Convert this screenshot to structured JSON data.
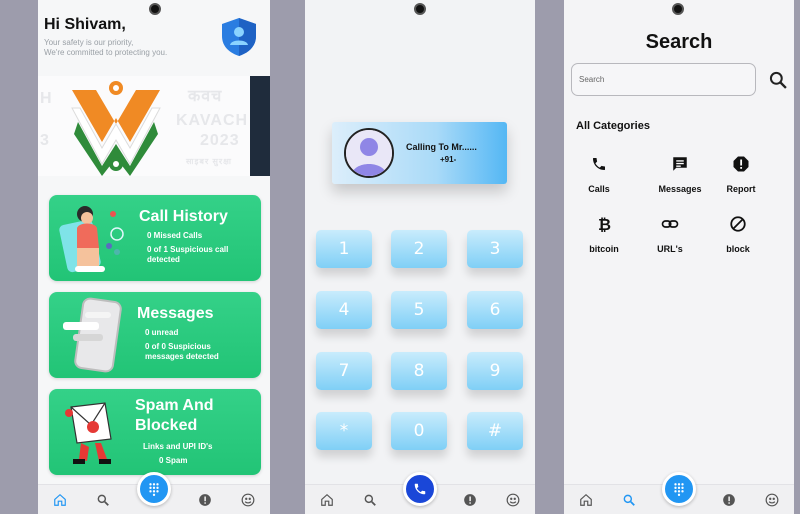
{
  "home": {
    "greeting": "Hi Shivam,",
    "subtitle_1": "Your safety is our priority,",
    "subtitle_2": "We're committed to protecting you.",
    "banner_words": [
      "कवच",
      "KAVACH",
      "2023",
      "साइबर सुरक्षा",
      "H",
      "3"
    ],
    "cards": [
      {
        "title": "Call History",
        "line_1": "0 Missed Calls",
        "line_2": "0 of 1 Suspicious call",
        "line_3": "detected"
      },
      {
        "title": "Messages",
        "line_1": "0 unread",
        "line_2": "0 of 0 Suspicious",
        "line_3": "messages detected"
      },
      {
        "title_1": "Spam And",
        "title_2": "Blocked",
        "line_1": "Links and UPI ID's",
        "line_2": "0 Spam"
      }
    ]
  },
  "dialer": {
    "calling_line_1": "Calling To Mr......",
    "calling_line_2": "+91-",
    "keys": [
      "1",
      "2",
      "3",
      "4",
      "5",
      "6",
      "7",
      "8",
      "9",
      "*",
      "0",
      "#"
    ]
  },
  "search": {
    "title": "Search",
    "placeholder": "Search",
    "section_title": "All Categories",
    "categories": [
      {
        "label": "Calls",
        "icon": "phone-icon"
      },
      {
        "label": "Messages",
        "icon": "message-icon"
      },
      {
        "label": "Report",
        "icon": "report-icon"
      },
      {
        "label": "bitcoin",
        "icon": "bitcoin-icon"
      },
      {
        "label": "URL's",
        "icon": "link-icon"
      },
      {
        "label": "block",
        "icon": "block-icon"
      }
    ]
  },
  "nav_icons": [
    "home-icon",
    "search-icon",
    "dialpad-icon",
    "alert-icon",
    "profile-icon"
  ],
  "colors": {
    "card_green": "#2ac87c",
    "fab_blue": "#2196f3",
    "active_nav": "#2196f3",
    "dial_key": "#8fd5f7",
    "call_fab": "#1a47d8"
  }
}
